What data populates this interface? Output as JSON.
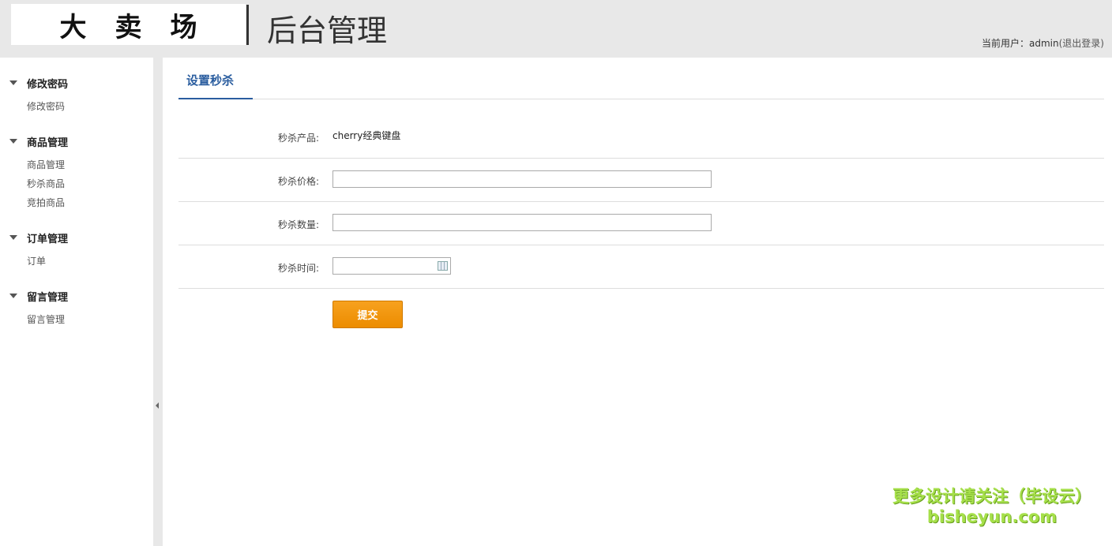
{
  "header": {
    "logo_text": "大卖场",
    "title": "后台管理",
    "user_label": "当前用户：",
    "user_name": "admin",
    "logout_label": "(退出登录)"
  },
  "sidebar": {
    "groups": [
      {
        "title": "修改密码",
        "items": [
          "修改密码"
        ]
      },
      {
        "title": "商品管理",
        "items": [
          "商品管理",
          "秒杀商品",
          "竞拍商品"
        ]
      },
      {
        "title": "订单管理",
        "items": [
          "订单"
        ]
      },
      {
        "title": "留言管理",
        "items": [
          "留言管理"
        ]
      }
    ]
  },
  "main": {
    "tab_label": "设置秒杀",
    "form": {
      "product_label": "秒杀产品:",
      "product_value": "cherry经典键盘",
      "price_label": "秒杀价格:",
      "price_value": "",
      "quantity_label": "秒杀数量:",
      "quantity_value": "",
      "time_label": "秒杀时间:",
      "time_value": "",
      "submit_label": "提交"
    }
  },
  "watermark": {
    "line1": "更多设计请关注（毕设云）",
    "line2": "bisheyun.com"
  }
}
